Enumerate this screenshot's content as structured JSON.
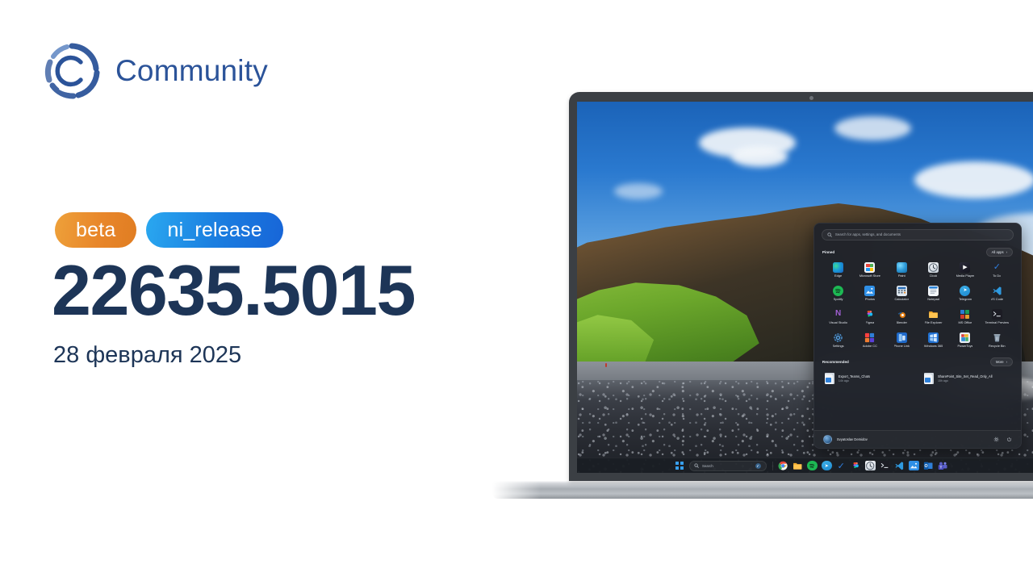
{
  "brand": {
    "name": "Community",
    "logo_icon": "community-circle-c-logo",
    "color": "#2b5399"
  },
  "release": {
    "badges": [
      {
        "label": "beta",
        "kind": "channel",
        "color": "#e8862a"
      },
      {
        "label": "ni_release",
        "kind": "branch",
        "color": "#1b7fe0"
      }
    ],
    "build_number": "22635.5015",
    "date": "28 февраля 2025",
    "text_color": "#1d3557"
  },
  "device": {
    "name": "laptop-mockup",
    "webcam_icon": "webcam-dot",
    "wallpaper": "black-sand-beach-cliff-photo"
  },
  "start_menu": {
    "search": {
      "placeholder": "Search for apps, settings, and documents",
      "icon": "search-icon"
    },
    "pinned": {
      "title": "Pinned",
      "all_apps_label": "All apps",
      "all_apps_chevron": "›",
      "apps": [
        {
          "label": "Edge",
          "icon": "edge-icon"
        },
        {
          "label": "Microsoft Store",
          "icon": "microsoft-store-icon"
        },
        {
          "label": "Paint",
          "icon": "paint-icon"
        },
        {
          "label": "Clock",
          "icon": "clock-icon"
        },
        {
          "label": "Media Player",
          "icon": "media-player-icon"
        },
        {
          "label": "To Do",
          "icon": "to-do-icon"
        },
        {
          "label": "Spotify",
          "icon": "spotify-icon"
        },
        {
          "label": "Photos",
          "icon": "photos-icon"
        },
        {
          "label": "Calculator",
          "icon": "calculator-icon"
        },
        {
          "label": "Notepad",
          "icon": "notepad-icon"
        },
        {
          "label": "Telegram",
          "icon": "telegram-icon"
        },
        {
          "label": "VS Code",
          "icon": "vs-code-icon"
        },
        {
          "label": "Visual Studio",
          "icon": "visual-studio-icon"
        },
        {
          "label": "Figma",
          "icon": "figma-icon"
        },
        {
          "label": "Blender",
          "icon": "blender-icon"
        },
        {
          "label": "File Explorer",
          "icon": "file-explorer-icon"
        },
        {
          "label": "MS Office",
          "icon": "ms-office-icon"
        },
        {
          "label": "Terminal Preview",
          "icon": "terminal-preview-icon"
        },
        {
          "label": "Settings",
          "icon": "settings-gear-icon"
        },
        {
          "label": "Adobe CC",
          "icon": "adobe-cc-icon"
        },
        {
          "label": "Phone Link",
          "icon": "phone-link-icon"
        },
        {
          "label": "Windows 365",
          "icon": "windows-365-icon"
        },
        {
          "label": "PowerToys",
          "icon": "powertoys-icon"
        },
        {
          "label": "Recycle Bin",
          "icon": "recycle-bin-icon"
        }
      ]
    },
    "recommended": {
      "title": "Recommended",
      "more_label": "More",
      "more_chevron": "›",
      "items": [
        {
          "name": "Export_Teams_Chats",
          "time": "14h ago",
          "icon": "document-file-icon"
        },
        {
          "name": "SharePoint_Site_Set_Read_Only_All",
          "time": "15h ago",
          "icon": "document-file-icon"
        }
      ]
    },
    "footer": {
      "user_name": "Svyatoslav Demidov",
      "avatar_icon": "user-avatar",
      "settings_icon": "settings-gear-icon",
      "power_icon": "power-icon"
    }
  },
  "taskbar": {
    "start_label": "Start",
    "start_icon": "windows-start-icon",
    "search": {
      "placeholder": "Search",
      "icon": "search-icon",
      "copilot_icon": "copilot-icon"
    },
    "items": [
      {
        "label": "Chrome",
        "icon": "chrome-icon"
      },
      {
        "label": "File Explorer",
        "icon": "file-explorer-icon"
      },
      {
        "label": "Spotify",
        "icon": "spotify-icon"
      },
      {
        "label": "Telegram",
        "icon": "telegram-icon"
      },
      {
        "label": "To Do",
        "icon": "to-do-icon"
      },
      {
        "label": "Figma",
        "icon": "figma-icon"
      },
      {
        "label": "Clock",
        "icon": "clock-icon"
      },
      {
        "label": "Terminal",
        "icon": "terminal-icon"
      },
      {
        "label": "VS Code",
        "icon": "vs-code-icon"
      },
      {
        "label": "Photos",
        "icon": "photos-icon"
      },
      {
        "label": "Outlook",
        "icon": "outlook-icon"
      },
      {
        "label": "Teams",
        "icon": "teams-icon"
      }
    ]
  }
}
